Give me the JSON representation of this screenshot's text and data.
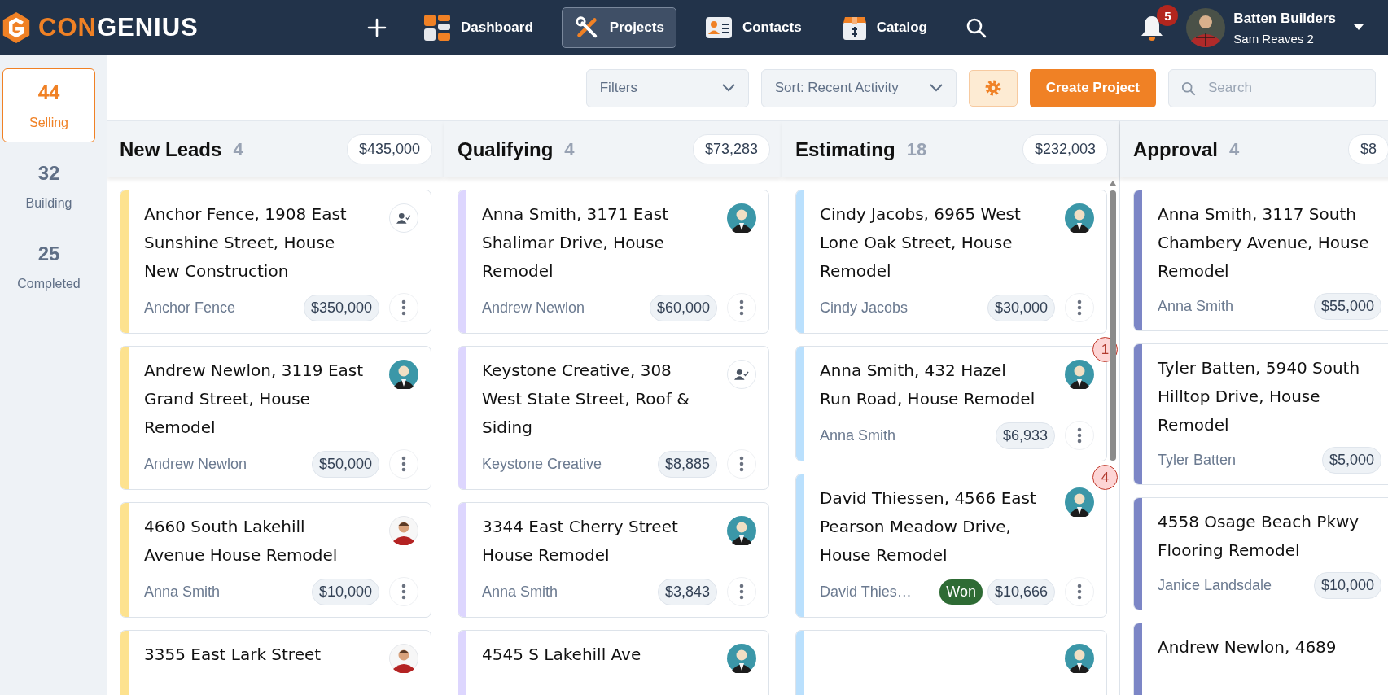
{
  "brand": {
    "accent": "CON",
    "rest": "GENIUS"
  },
  "nav": [
    {
      "label": "Dashboard",
      "kind": "dashboard",
      "selected": false
    },
    {
      "label": "Projects",
      "kind": "projects",
      "selected": true
    },
    {
      "label": "Contacts",
      "kind": "contacts",
      "selected": false
    },
    {
      "label": "Catalog",
      "kind": "catalog",
      "selected": false
    }
  ],
  "notifications": {
    "count": "5"
  },
  "account": {
    "company": "Batten Builders",
    "user": "Sam Reaves 2"
  },
  "sidebar": {
    "items": [
      {
        "count": "44",
        "label": "Selling",
        "selected": true
      },
      {
        "count": "32",
        "label": "Building",
        "selected": false
      },
      {
        "count": "25",
        "label": "Completed",
        "selected": false
      }
    ]
  },
  "toolbar": {
    "filters": "Filters",
    "sort": "Sort: Recent Activity",
    "create": "Create Project",
    "search": {
      "placeholder": "Search"
    }
  },
  "columns": [
    {
      "title": "New Leads",
      "count": "4",
      "total": "$435,000",
      "color": "#fde28f",
      "cards": [
        {
          "title": "Anchor Fence, 1908 East Sunshine Street, House New Construction",
          "client": "Anchor Fence",
          "amount": "$350,000",
          "avatar": {
            "kind": "unassigned"
          }
        },
        {
          "title": "Andrew Newlon, 3119 East Grand Street, House Remodel",
          "client": "Andrew Newlon",
          "amount": "$50,000",
          "avatar": {
            "kind": "woman"
          }
        },
        {
          "title": "4660 South Lakehill Avenue House Remodel",
          "client": "Anna Smith",
          "amount": "$10,000",
          "avatar": {
            "kind": "man"
          }
        },
        {
          "title": "3355 East Lark Street",
          "avatar": {
            "kind": "man"
          }
        }
      ]
    },
    {
      "title": "Qualifying",
      "count": "4",
      "total": "$73,283",
      "color": "#ddd6fe",
      "cards": [
        {
          "title": "Anna Smith, 3171 East Shalimar Drive, House Remodel",
          "client": "Andrew Newlon",
          "amount": "$60,000",
          "avatar": {
            "kind": "woman"
          }
        },
        {
          "title": "Keystone Creative, 308 West State Street, Roof & Siding",
          "client": "Keystone Creative",
          "amount": "$8,885",
          "avatar": {
            "kind": "unassigned"
          }
        },
        {
          "title": "3344 East Cherry Street House Remodel",
          "client": "Anna Smith",
          "amount": "$3,843",
          "avatar": {
            "kind": "woman"
          }
        },
        {
          "title": "4545 S Lakehill Ave",
          "avatar": {
            "kind": "woman"
          }
        }
      ]
    },
    {
      "title": "Estimating",
      "count": "18",
      "total": "$232,003",
      "color": "#bae0fd",
      "scrollbar": true,
      "cards": [
        {
          "title": "Cindy Jacobs, 6965 West Lone Oak Street, House Remodel",
          "client": "Cindy Jacobs",
          "amount": "$30,000",
          "avatar": {
            "kind": "woman"
          }
        },
        {
          "title": "Anna Smith, 432 Hazel Run Road, House Remodel",
          "client": "Anna Smith",
          "amount": "$6,933",
          "avatar": {
            "kind": "woman"
          },
          "alert": "1"
        },
        {
          "title": "David Thiessen, 4566 East Pearson Meadow Drive, House Remodel",
          "client": "David Thies…",
          "tag": "Won",
          "amount": "$10,666",
          "avatar": {
            "kind": "woman"
          },
          "alert": "4"
        },
        {
          "avatar": {
            "kind": "woman"
          }
        }
      ]
    },
    {
      "title": "Approval",
      "count": "4",
      "total": "$8",
      "color": "#7c86c6",
      "cards": [
        {
          "title": "Anna Smith, 3117 South Chambery Avenue, House Remodel",
          "client": "Anna Smith",
          "amount": "$55,000"
        },
        {
          "title": "Tyler Batten, 5940 South Hilltop Drive, House Remodel",
          "client": "Tyler Batten",
          "amount": "$5,000"
        },
        {
          "title": "4558 Osage Beach Pkwy Flooring Remodel",
          "client": "Janice Landsdale",
          "amount": "$10,000"
        },
        {
          "title": "Andrew Newlon, 4689"
        }
      ]
    }
  ]
}
